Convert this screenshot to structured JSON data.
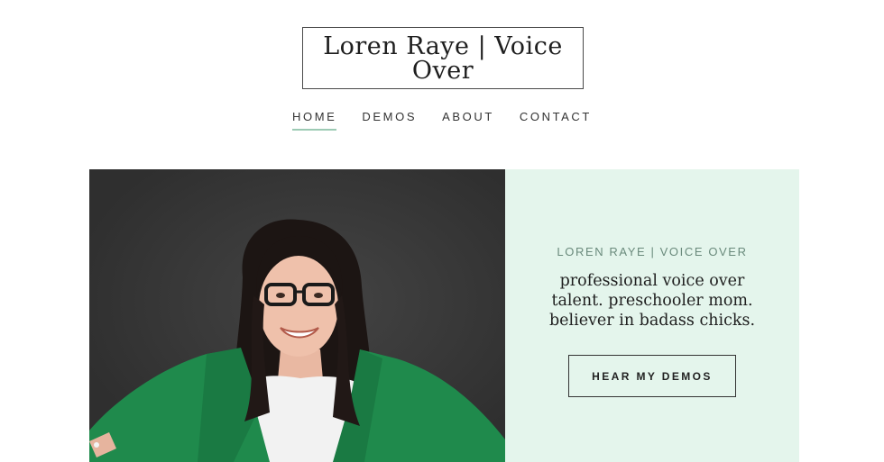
{
  "site": {
    "title": "Loren Raye | Voice Over"
  },
  "nav": {
    "items": [
      {
        "label": "HOME",
        "active": true
      },
      {
        "label": "DEMOS",
        "active": false
      },
      {
        "label": "ABOUT",
        "active": false
      },
      {
        "label": "CONTACT",
        "active": false
      }
    ]
  },
  "hero": {
    "eyebrow": "LOREN RAYE | VOICE OVER",
    "tagline": "professional voice over talent. preschooler mom. believer in badass chicks.",
    "cta_label": "HEAR MY DEMOS",
    "colors": {
      "panel_bg": "#e4f5ec",
      "photo_bg": "#373737",
      "blazer": "#1f8a4c",
      "nav_underline": "#9ccab4"
    }
  }
}
